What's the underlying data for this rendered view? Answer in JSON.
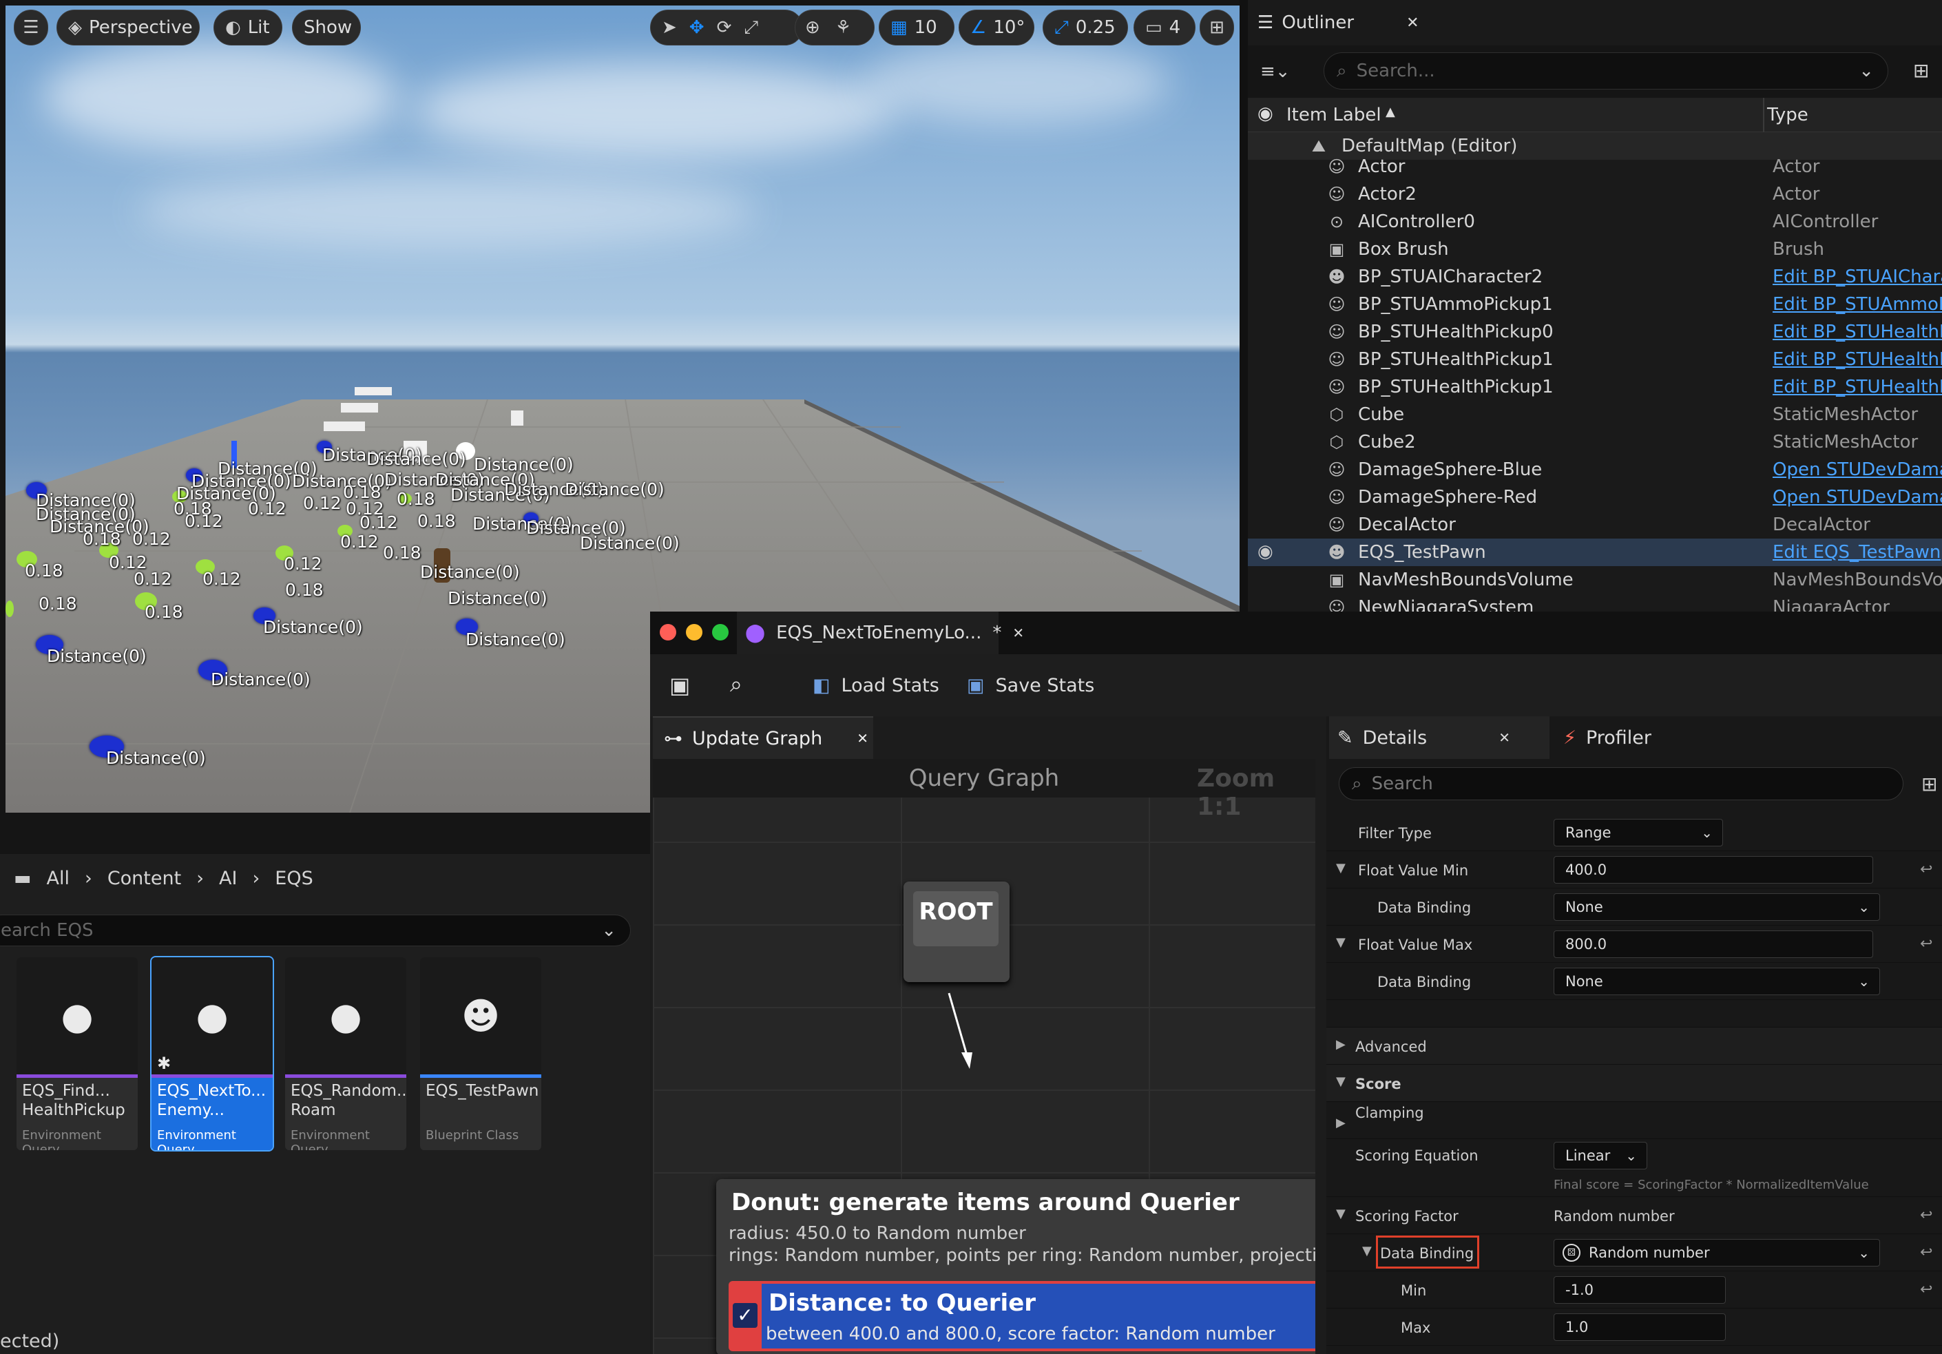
{
  "viewport": {
    "menu_icon": "hamburger-icon",
    "perspective_label": "Perspective",
    "lit_label": "Lit",
    "show_label": "Show",
    "grid_snap_value": "10",
    "rotate_snap_value": "10°",
    "scale_snap_value": "0.25",
    "camera_speed_value": "4",
    "labels": {
      "d0": "Distance(0)",
      "v12": "0.12",
      "v18": "0.18"
    }
  },
  "outliner": {
    "tab_label": "Outliner",
    "search_placeholder": "Search...",
    "col_label": "Item Label",
    "col_type": "Type",
    "root": "DefaultMap (Editor)",
    "rows": [
      {
        "name": "Actor",
        "type": "Actor",
        "link": false
      },
      {
        "name": "Actor2",
        "type": "Actor",
        "link": false
      },
      {
        "name": "AIController0",
        "type": "AIController",
        "link": false
      },
      {
        "name": "Box Brush",
        "type": "Brush",
        "link": false
      },
      {
        "name": "BP_STUAICharacter2",
        "type": "Edit BP_STUAIChara",
        "link": true
      },
      {
        "name": "BP_STUAmmoPickup1",
        "type": "Edit BP_STUAmmoP",
        "link": true
      },
      {
        "name": "BP_STUHealthPickup0",
        "type": "Edit BP_STUHealthP",
        "link": true
      },
      {
        "name": "BP_STUHealthPickup1",
        "type": "Edit BP_STUHealthP",
        "link": true
      },
      {
        "name": "BP_STUHealthPickup1",
        "type": "Edit BP_STUHealthP",
        "link": true
      },
      {
        "name": "Cube",
        "type": "StaticMeshActor",
        "link": false
      },
      {
        "name": "Cube2",
        "type": "StaticMeshActor",
        "link": false
      },
      {
        "name": "DamageSphere-Blue",
        "type": "Open STUDevDamag",
        "link": true
      },
      {
        "name": "DamageSphere-Red",
        "type": "Open STUDevDamag",
        "link": true
      },
      {
        "name": "DecalActor",
        "type": "DecalActor",
        "link": false
      },
      {
        "name": "EQS_TestPawn",
        "type": "Edit EQS_TestPawn",
        "link": true
      },
      {
        "name": "NavMeshBoundsVolume",
        "type": "NavMeshBoundsVolu",
        "link": false
      },
      {
        "name": "NewNiagaraSystem",
        "type": "NiagaraActor",
        "link": false
      }
    ]
  },
  "content_browser": {
    "crumbs": [
      "All",
      "Content",
      "AI",
      "EQS"
    ],
    "search_placeholder": "earch EQS",
    "status": "ected)",
    "tiles": [
      {
        "l1": "EQS_Find...",
        "l2": "HealthPickup",
        "type": "Environment Query"
      },
      {
        "l1": "EQS_NextTo...",
        "l2": "Enemy...",
        "type": "Environment Query"
      },
      {
        "l1": "EQS_Random...",
        "l2": "Roam",
        "type": "Environment Query"
      },
      {
        "l1": "EQS_TestPawn",
        "l2": "",
        "type": "Blueprint Class"
      }
    ]
  },
  "eqs": {
    "window_title": "EQS_NextToEnemyLo...",
    "modified_mark": "*",
    "load_stats": "Load Stats",
    "save_stats": "Save Stats",
    "graph_tab": "Update Graph",
    "graph_header": "Query Graph",
    "zoom": "Zoom 1:1",
    "root_label": "ROOT",
    "donut_title": "Donut: generate items around Querier",
    "donut_line1": "radius: 450.0 to Random number",
    "donut_line2": "rings: Random number, points per ring: Random number, projection",
    "test_title": "Distance: to Querier",
    "test_sub": "between 400.0 and 800.0, score factor: Random number"
  },
  "details": {
    "tab_details": "Details",
    "tab_profiler": "Profiler",
    "search_placeholder": "Search",
    "filter_type_k": "Filter Type",
    "filter_type_v": "Range",
    "fmin_k": "Float Value Min",
    "fmin_v": "400.0",
    "binding_k": "Data Binding",
    "none_v": "None",
    "fmax_k": "Float Value Max",
    "fmax_v": "800.0",
    "advanced": "Advanced",
    "score": "Score",
    "clamping": "Clamping",
    "eq_k": "Scoring Equation",
    "eq_v": "Linear",
    "eq_hint": "Final score = ScoringFactor * NormalizedItemValue",
    "sf_k": "Scoring Factor",
    "sf_v": "Random number",
    "rand_v": "Random number",
    "min_k": "Min",
    "min_v": "-1.0",
    "max_k": "Max",
    "max_v": "1.0"
  }
}
